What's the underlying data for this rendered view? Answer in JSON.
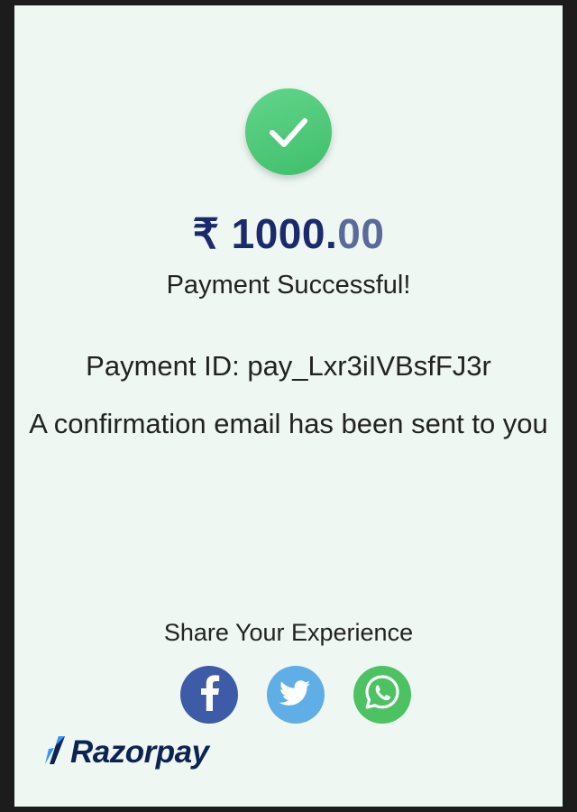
{
  "payment": {
    "currency_symbol": "₹",
    "amount_whole": "1000.",
    "amount_decimals": "00",
    "status": "Payment Successful!",
    "payment_id_text": "Payment ID: pay_Lxr3iIVBsfFJ3r",
    "confirmation_text": "A confirmation email has been sent to you"
  },
  "share": {
    "title": "Share Your Experience",
    "icons": [
      "facebook-icon",
      "twitter-icon",
      "whatsapp-icon"
    ]
  },
  "brand": {
    "name": "Razorpay"
  },
  "colors": {
    "success": "#4cc775",
    "amount": "#1a2a6c",
    "background": "#eef7f1",
    "facebook": "#3d5ba7",
    "twitter": "#60aee6",
    "whatsapp": "#4dc263",
    "brand": "#0c2451"
  }
}
